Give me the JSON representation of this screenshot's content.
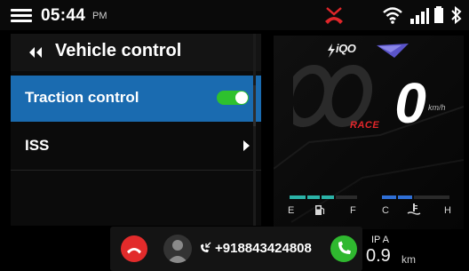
{
  "status_bar": {
    "time": "05:44",
    "ampm": "PM"
  },
  "panel": {
    "title": "Vehicle control",
    "items": [
      {
        "label": "Traction control",
        "toggle": "on"
      },
      {
        "label": "ISS"
      }
    ]
  },
  "dashboard": {
    "brand": "iQO",
    "speed": "0",
    "unit": "km/h",
    "mode": "RACE",
    "fuel": {
      "empty_label": "E",
      "full_label": "F"
    },
    "temp": {
      "cold_label": "C",
      "hot_label": "H"
    }
  },
  "call": {
    "number": "+918843424808"
  },
  "trip": {
    "label": "IP A",
    "value": "0.9",
    "unit": "km"
  },
  "colors": {
    "accent": "#1a6bb0",
    "toggle_on": "#2ec12e",
    "mode": "#e0262a",
    "decline": "#e22b2b",
    "accept": "#2fb82f"
  }
}
